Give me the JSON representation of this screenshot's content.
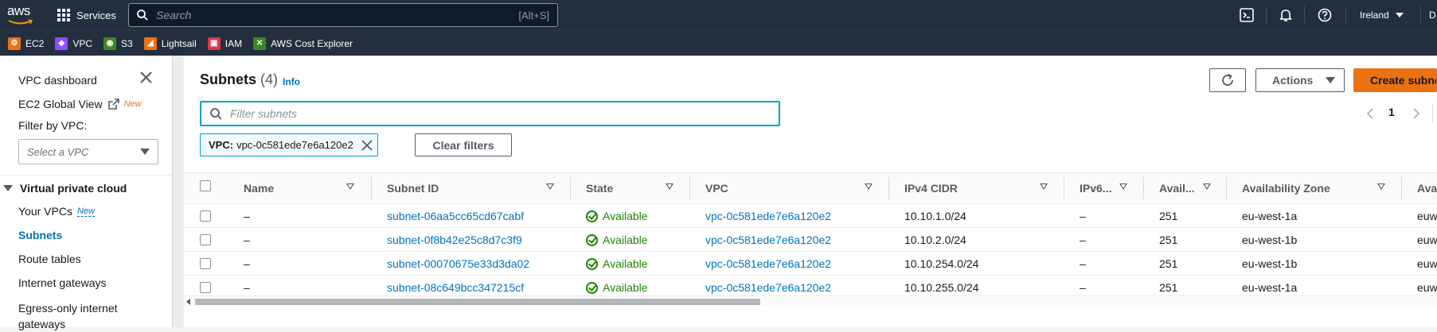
{
  "topnav": {
    "services_label": "Services",
    "search_placeholder": "Search",
    "search_shortcut": "[Alt+S]",
    "region": "Ireland",
    "account_initial": "D"
  },
  "favorites": [
    {
      "label": "EC2",
      "color": "#ec7211",
      "icon": "ec2-icon"
    },
    {
      "label": "VPC",
      "color": "#8c4fff",
      "icon": "vpc-icon"
    },
    {
      "label": "S3",
      "color": "#3f8624",
      "icon": "s3-icon"
    },
    {
      "label": "Lightsail",
      "color": "#ec7211",
      "icon": "lightsail-icon"
    },
    {
      "label": "IAM",
      "color": "#dd344c",
      "icon": "iam-icon"
    },
    {
      "label": "AWS Cost Explorer",
      "color": "#3f8624",
      "icon": "cost-explorer-icon"
    }
  ],
  "sidebar": {
    "dashboard": "VPC dashboard",
    "ec2_global_view": "EC2 Global View",
    "new_tag": "New",
    "filter_label": "Filter by VPC:",
    "select_placeholder": "Select a VPC",
    "section": "Virtual private cloud",
    "items": [
      {
        "label": "Your VPCs",
        "tag": "New"
      },
      {
        "label": "Subnets"
      },
      {
        "label": "Route tables"
      },
      {
        "label": "Internet gateways"
      },
      {
        "label": "Egress-only internet gateways"
      }
    ]
  },
  "main": {
    "title": "Subnets",
    "count": "(4)",
    "info": "Info",
    "actions_label": "Actions",
    "create_label": "Create subnet",
    "filter_placeholder": "Filter subnets",
    "page": "1",
    "token_key": "VPC:",
    "token_value": "vpc-0c581ede7e6a120e2",
    "clear_filters": "Clear filters"
  },
  "table": {
    "columns": [
      "Name",
      "Subnet ID",
      "State",
      "VPC",
      "IPv4 CIDR",
      "IPv6...",
      "Avail...",
      "Availability Zone",
      "Ava"
    ],
    "rows": [
      {
        "name": "–",
        "subnet_id": "subnet-06aa5cc65cd67cabf",
        "state": "Available",
        "vpc": "vpc-0c581ede7e6a120e2",
        "ipv4": "10.10.1.0/24",
        "ipv6": "–",
        "avail": "251",
        "az": "eu-west-1a",
        "azid": "euw"
      },
      {
        "name": "–",
        "subnet_id": "subnet-0f8b42e25c8d7c3f9",
        "state": "Available",
        "vpc": "vpc-0c581ede7e6a120e2",
        "ipv4": "10.10.2.0/24",
        "ipv6": "–",
        "avail": "251",
        "az": "eu-west-1b",
        "azid": "euw"
      },
      {
        "name": "–",
        "subnet_id": "subnet-00070675e33d3da02",
        "state": "Available",
        "vpc": "vpc-0c581ede7e6a120e2",
        "ipv4": "10.10.254.0/24",
        "ipv6": "–",
        "avail": "251",
        "az": "eu-west-1b",
        "azid": "euw"
      },
      {
        "name": "–",
        "subnet_id": "subnet-08c649bcc347215cf",
        "state": "Available",
        "vpc": "vpc-0c581ede7e6a120e2",
        "ipv4": "10.10.255.0/24",
        "ipv6": "–",
        "avail": "251",
        "az": "eu-west-1a",
        "azid": "euw"
      }
    ]
  }
}
